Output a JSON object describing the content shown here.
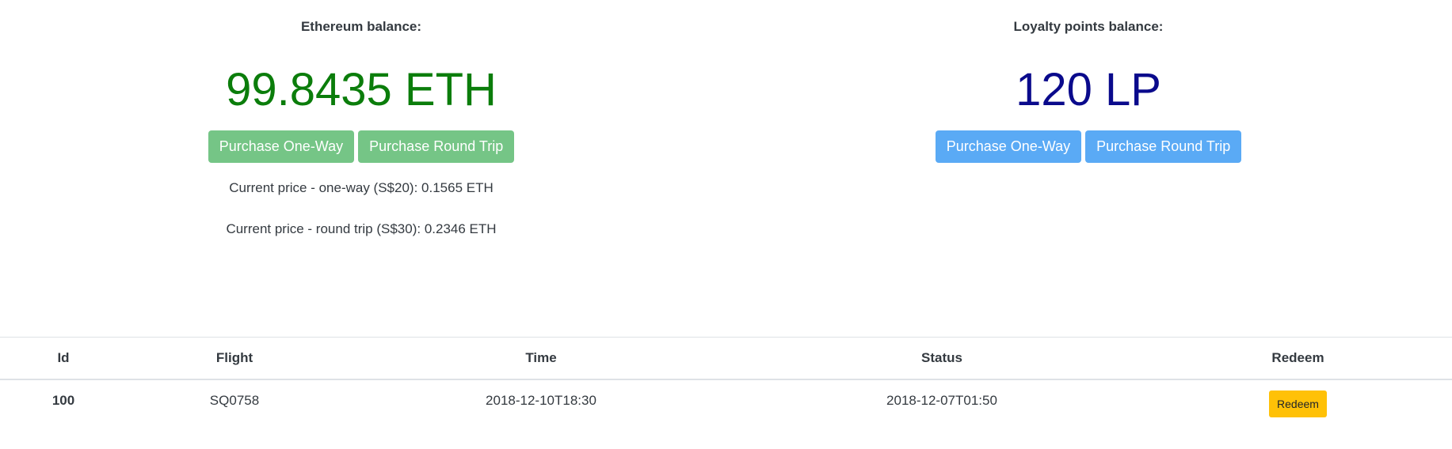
{
  "ethereum": {
    "label": "Ethereum balance:",
    "value": "99.8435 ETH",
    "color": "#0b7d0b",
    "buttons": {
      "one_way": "Purchase One-Way",
      "round_trip": "Purchase Round Trip"
    },
    "prices": {
      "one_way": "Current price - one-way (S$20): 0.1565 ETH",
      "round_trip": "Current price - round trip (S$30): 0.2346 ETH"
    }
  },
  "loyalty": {
    "label": "Loyalty points balance:",
    "value": "120 LP",
    "color": "#0a0a8c",
    "buttons": {
      "one_way": "Purchase One-Way",
      "round_trip": "Purchase Round Trip"
    }
  },
  "table": {
    "headers": {
      "id": "Id",
      "flight": "Flight",
      "time": "Time",
      "status": "Status",
      "redeem": "Redeem"
    },
    "rows": [
      {
        "id": "100",
        "flight": "SQ0758",
        "time": "2018-12-10T18:30",
        "status": "2018-12-07T01:50",
        "redeem_label": "Redeem"
      }
    ]
  },
  "colors": {
    "green_button": "#75c586",
    "blue_button": "#5aaaf5",
    "redeem_button": "#ffc107"
  }
}
